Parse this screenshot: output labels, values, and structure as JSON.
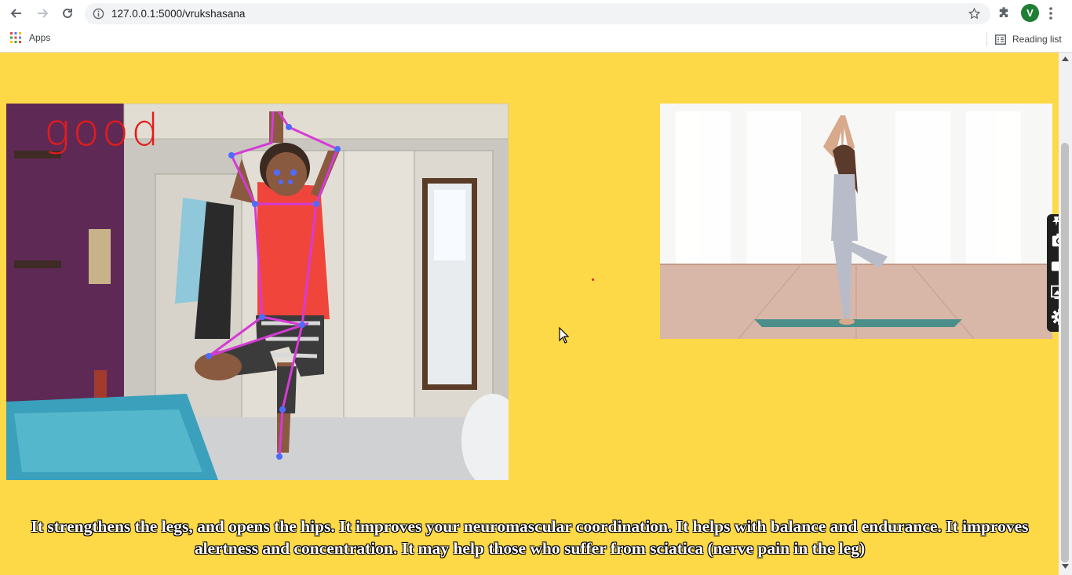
{
  "browser": {
    "url": "127.0.0.1:5000/vrukshasana",
    "avatar_letter": "V",
    "bookmarks": {
      "apps_label": "Apps",
      "reading_list_label": "Reading list"
    }
  },
  "page": {
    "background_color": "#fdd947",
    "pose_status": "good",
    "description": "It strengthens the legs, and opens the hips. It improves your neuromascular coordination. It helps with balance and endurance. It improves alertness and concentration. It may help those who suffer from sciatica (nerve pain in the leg)"
  },
  "side_widget": {
    "icons": [
      "pin-icon",
      "camera-icon",
      "video-icon",
      "gallery-icon",
      "settings-icon"
    ]
  },
  "colors": {
    "skeleton": "#d63ad6",
    "keypoint": "#4f6bff",
    "status": "#e41b1b"
  }
}
